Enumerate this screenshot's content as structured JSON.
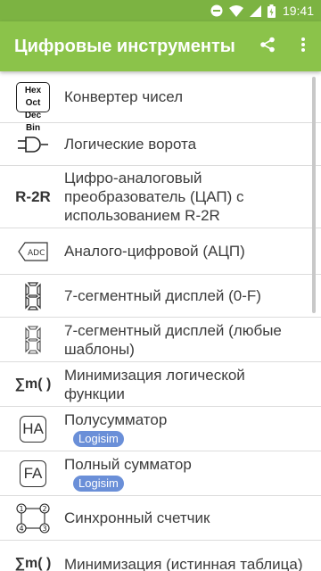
{
  "status_bar": {
    "time": "19:41",
    "icons": [
      "do-not-disturb-icon",
      "wifi-icon",
      "signal-icon",
      "battery-icon"
    ],
    "color": "#7cb342"
  },
  "app_bar": {
    "title": "Цифровые инструменты",
    "color": "#8bc34a",
    "actions": [
      "share-icon",
      "more-vert-icon"
    ]
  },
  "list": {
    "items": [
      {
        "label": "Конвертер чисел",
        "icon": "hex-oct-dec-bin-icon",
        "icon_text": [
          "Hex Oct",
          "Dec Bin"
        ]
      },
      {
        "label": "Логические ворота",
        "icon": "logic-gate-icon"
      },
      {
        "label": "Цифро-аналоговый преобразователь (ЦАП) с использованием R-2R",
        "icon": "r2r-icon",
        "icon_text": "R-2R"
      },
      {
        "label": "Аналого-цифровой (АЦП)",
        "icon": "adc-icon",
        "icon_text": "ADC"
      },
      {
        "label": "7-сегментный дисплей (0-F)",
        "icon": "seven-segment-icon"
      },
      {
        "label": "7-сегментный дисплей (любые шаблоны)",
        "icon": "seven-segment-outline-icon"
      },
      {
        "label": "Минимизация логической функции",
        "icon": "sum-of-minterms-icon",
        "icon_text": "∑m( )"
      },
      {
        "label": "Полусумматор",
        "icon": "half-adder-icon",
        "icon_text": "HA",
        "badge": "Logisim"
      },
      {
        "label": "Полный сумматор",
        "icon": "full-adder-icon",
        "icon_text": "FA",
        "badge": "Logisim"
      },
      {
        "label": "Синхронный счетчик",
        "icon": "sync-counter-icon",
        "icon_text": [
          "1",
          "2",
          "3",
          "4"
        ]
      },
      {
        "label": "Минимизация (истинная таблица)",
        "icon": "sum-of-minterms-icon",
        "icon_text": "∑m( )"
      }
    ]
  },
  "accent": {
    "badge": "#6a8fd8"
  }
}
